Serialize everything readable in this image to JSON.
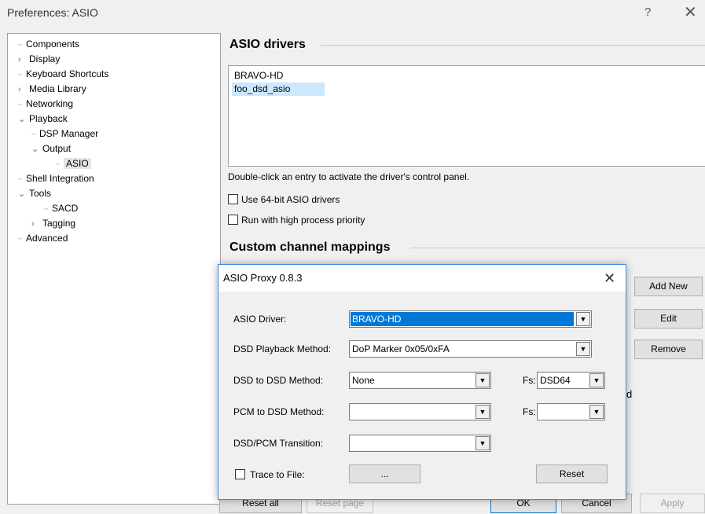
{
  "window": {
    "title": "Preferences: ASIO",
    "help_label": "?",
    "close_label": "✕"
  },
  "tree": [
    {
      "label": "Components",
      "expander": "",
      "selected": false
    },
    {
      "label": "Display",
      "expander": "›",
      "selected": false
    },
    {
      "label": "Keyboard Shortcuts",
      "expander": "",
      "selected": false
    },
    {
      "label": "Media Library",
      "expander": "›",
      "selected": false
    },
    {
      "label": "Networking",
      "expander": "",
      "selected": false
    },
    {
      "label": "Playback",
      "expander": "⌄",
      "selected": false
    },
    {
      "label": "DSP Manager",
      "expander": "",
      "selected": false
    },
    {
      "label": "Output",
      "expander": "⌄",
      "selected": false
    },
    {
      "label": "ASIO",
      "expander": "",
      "selected": true
    },
    {
      "label": "Shell Integration",
      "expander": "",
      "selected": false
    },
    {
      "label": "Tools",
      "expander": "⌄",
      "selected": false
    },
    {
      "label": "SACD",
      "expander": "",
      "selected": false
    },
    {
      "label": "Tagging",
      "expander": "›",
      "selected": false
    },
    {
      "label": "Advanced",
      "expander": "",
      "selected": false
    }
  ],
  "asio": {
    "section_title": "ASIO drivers",
    "drivers": [
      {
        "label": "BRAVO-HD",
        "selected": false
      },
      {
        "label": "foo_dsd_asio",
        "selected": true
      }
    ],
    "hint": "Double-click an entry to activate the driver's control panel.",
    "use64_label": "Use 64-bit ASIO drivers",
    "use64_checked": false,
    "priority_label": "Run with high process priority",
    "priority_checked": false
  },
  "mappings": {
    "section_title": "Custom channel mappings",
    "add_new_label": "Add New",
    "edit_label": "Edit",
    "remove_label": "Remove",
    "partial_text": "d"
  },
  "footer": {
    "reset_all_label": "Reset all",
    "reset_page_label": "Reset page",
    "ok_label": "OK",
    "cancel_label": "Cancel",
    "apply_label": "Apply"
  },
  "dialog": {
    "title": "ASIO Proxy 0.8.3",
    "close_label": "✕",
    "driver_label": "ASIO Driver:",
    "driver_value": "BRAVO-HD",
    "playback_label": "DSD Playback Method:",
    "playback_value": "DoP Marker 0x05/0xFA",
    "dsd2dsd_label": "DSD to DSD Method:",
    "dsd2dsd_value": "None",
    "fs_label": "Fs:",
    "dsd2dsd_fs_value": "DSD64",
    "pcm2dsd_label": "PCM to DSD Method:",
    "pcm2dsd_value": "",
    "pcm2dsd_fs_value": "",
    "transition_label": "DSD/PCM Transition:",
    "transition_value": "",
    "trace_label": "Trace to File:",
    "trace_checked": false,
    "browse_label": "...",
    "reset_label": "Reset"
  }
}
